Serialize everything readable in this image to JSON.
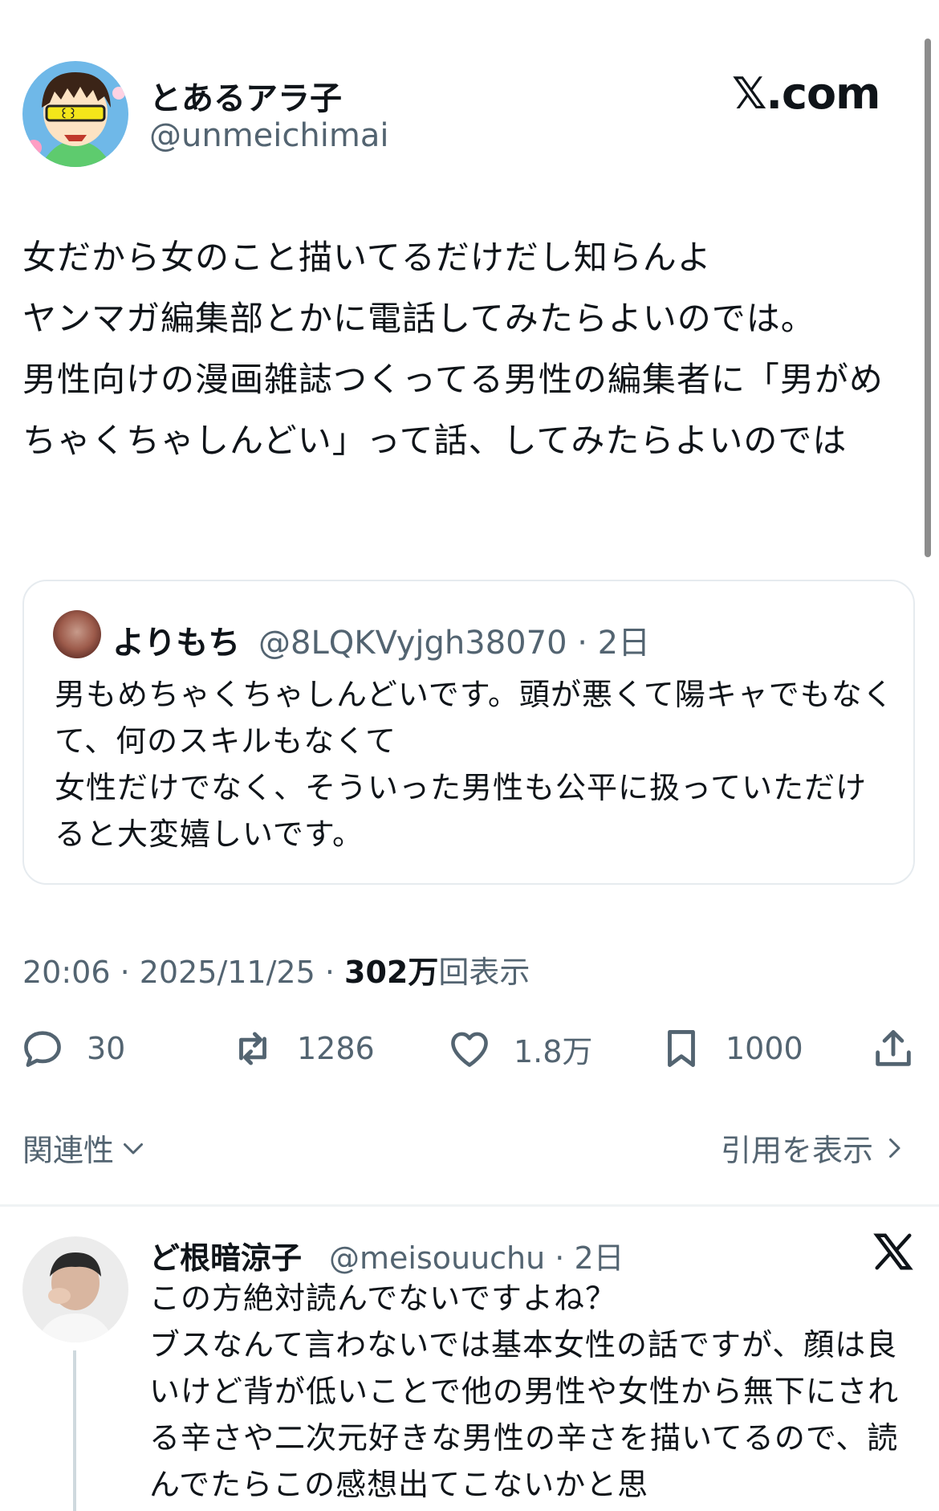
{
  "tweet": {
    "author_name": "とあるアラ子",
    "author_handle": "@unmeichimai",
    "brand": "𝕏.com",
    "text": "女だから女のこと描いてるだけだし知らんよ\nヤンマガ編集部とかに電話してみたらよいのでは。\n男性向けの漫画雑誌つくってる男性の編集者に「男がめちゃくちゃしんどい」って話、してみたらよいのでは"
  },
  "quote": {
    "name": "よりもち",
    "handle_time": "@8LQKVyjgh38070 · 2日",
    "text": "男もめちゃくちゃしんどいです。頭が悪くて陽キャでもなくて、何のスキルもなくて\n女性だけでなく、そういった男性も公平に扱っていただけると大変嬉しいです。"
  },
  "meta": {
    "timestamp": "20:06 · 2025/11/25 · ",
    "views_count": "302万",
    "views_label": "回表示"
  },
  "actions": {
    "replies": "30",
    "reposts": "1286",
    "likes": "1.8万",
    "bookmarks": "1000"
  },
  "icons": [
    "reply-icon",
    "repost-icon",
    "like-icon",
    "bookmark-icon",
    "share-icon",
    "chevron-down-icon",
    "chevron-right-icon",
    "x-logo-icon"
  ],
  "sort_label": "関連性",
  "view_quotes_label": "引用を表示",
  "reply": {
    "name": "ど根暗涼子",
    "handle_time": "@meisouuchu · 2日",
    "text": "この方絶対読んでないですよね？\nブスなんて言わないでは基本女性の話ですが、顔は良いけど背が低いことで他の男性や女性から無下にされる辛さや二次元好きな男性の辛さを描いてるので、読んでたらこの感想出てこないかと思"
  },
  "colors": {
    "text": "#0f1419",
    "secondary": "#536471",
    "border": "#e6ebef"
  }
}
